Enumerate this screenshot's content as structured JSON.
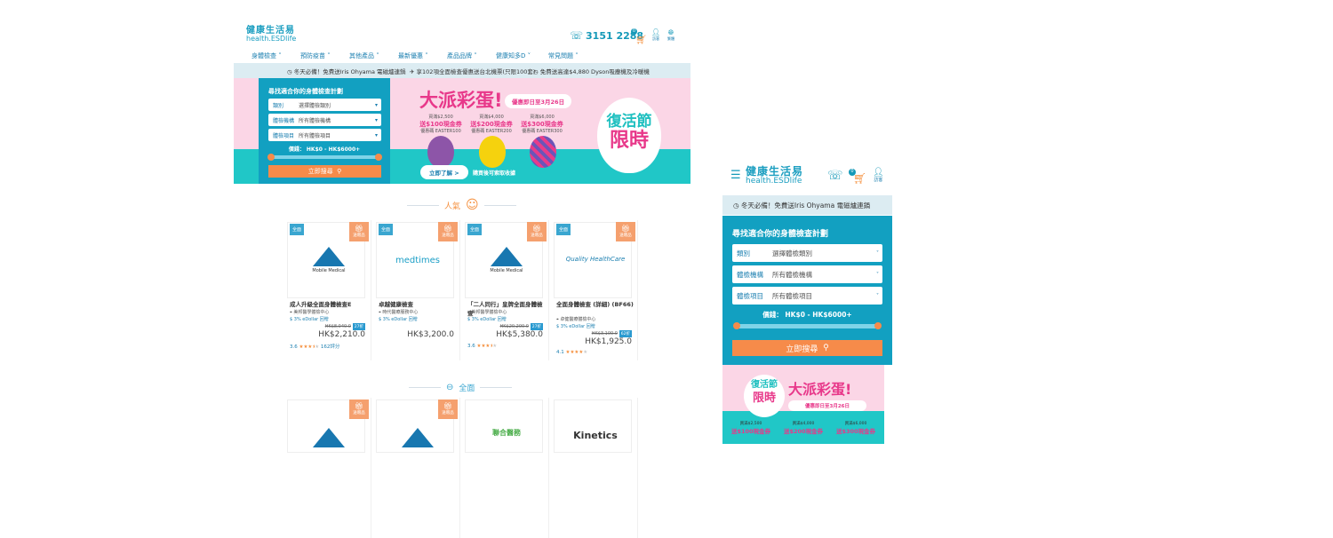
{
  "desktop": {
    "logo": {
      "zh": "健康生活易",
      "en": "health.ESDlife"
    },
    "phone": "3151 2288",
    "cart_count": "0",
    "guest": "訪客",
    "lang": "繁體",
    "nav": [
      "身體檢查",
      "預防疫苗",
      "其他產品",
      "最新優惠",
      "產品品牌",
      "健康知多D",
      "常見問題"
    ],
    "notices": [
      "冬天必備！免費送Iris Ohyama 電磁爐連鍋",
      "享102項全面檢查優惠送台北機票(只限100套)",
      "免費送高達$4,880 Dyson吸塵機及冷暖機"
    ],
    "search": {
      "title": "尋找適合你的身體檢查計劃",
      "fields": [
        {
          "label": "類別",
          "value": "選擇體檢類別"
        },
        {
          "label": "體檢機構",
          "value": "所有體檢機構"
        },
        {
          "label": "體檢項目",
          "value": "所有體檢項目"
        }
      ],
      "price_label": "價錢： HK$0 - HK$6000+",
      "price_range": [
        0,
        6000
      ],
      "button": "立即搜尋"
    },
    "banner": {
      "title": "大派彩蛋!",
      "period": "優惠即日至3月26日",
      "offers": [
        {
          "min": "買滿$2,500",
          "gift": "送$100現金券",
          "code": "優惠碼 EASTER100"
        },
        {
          "min": "買滿$4,000",
          "gift": "送$200現金券",
          "code": "優惠碼 EASTER200"
        },
        {
          "min": "買滿$6,000",
          "gift": "送$300現金券",
          "code": "優惠碼 EASTER300"
        }
      ],
      "cta": "立即了解 >",
      "note": "購買後可索取收據",
      "badge1": "復活節",
      "badge2": "限時"
    },
    "popular": {
      "title": "人氣",
      "cards": [
        {
          "tag": "全面",
          "gift": "送贈品",
          "brand": "Mobile Medical",
          "title": "成人升級全面身體檢查E",
          "location": "美邦醫學體檢中心",
          "edollar": "3% eDollar 回贈",
          "original": "HK$8,040.0",
          "discount": "27折",
          "price": "HK$2,210.0",
          "rating": "3.6",
          "stars": 3.5,
          "reviews": "162評分"
        },
        {
          "tag": "全面",
          "gift": "送贈品",
          "brand": "medtimes",
          "title": "卓越健康檢查",
          "location": "時代醫療服務中心",
          "edollar": "3% eDollar 回贈",
          "price": "HK$3,200.0"
        },
        {
          "tag": "全面",
          "gift": "送贈品",
          "brand": "Mobile Medical",
          "title": "「二人同行」皇牌全面身體檢查",
          "location": "美邦醫學體檢中心",
          "edollar": "3% eDollar 回贈",
          "original": "HK$20,200.0",
          "discount": "27折",
          "price": "HK$5,380.0",
          "rating": "3.6",
          "stars": 3.5
        },
        {
          "tag": "全面",
          "gift": "送贈品",
          "brand": "Quality HealthCare",
          "title": "全面身體檢查 (詳細) (BF66)",
          "location": "卓健醫療體檢中心",
          "edollar": "3% eDollar 回贈",
          "original": "HK$3,100.0",
          "discount": "62折",
          "price": "HK$1,925.0",
          "rating": "4.1",
          "stars": 4
        }
      ]
    },
    "comprehensive": {
      "title": "全面",
      "cards": [
        {
          "gift": "送贈品"
        },
        {
          "gift": "送贈品"
        },
        {
          "brand": "聯合醫務"
        },
        {
          "brand": "Kinetics"
        }
      ]
    }
  },
  "mobile": {
    "logo": {
      "zh": "健康生活易",
      "en": "health.ESDlife"
    },
    "cart_count": "0",
    "guest": "訪客",
    "notice": "冬天必備！免費送Iris Ohyama 電磁爐連鍋"
  }
}
